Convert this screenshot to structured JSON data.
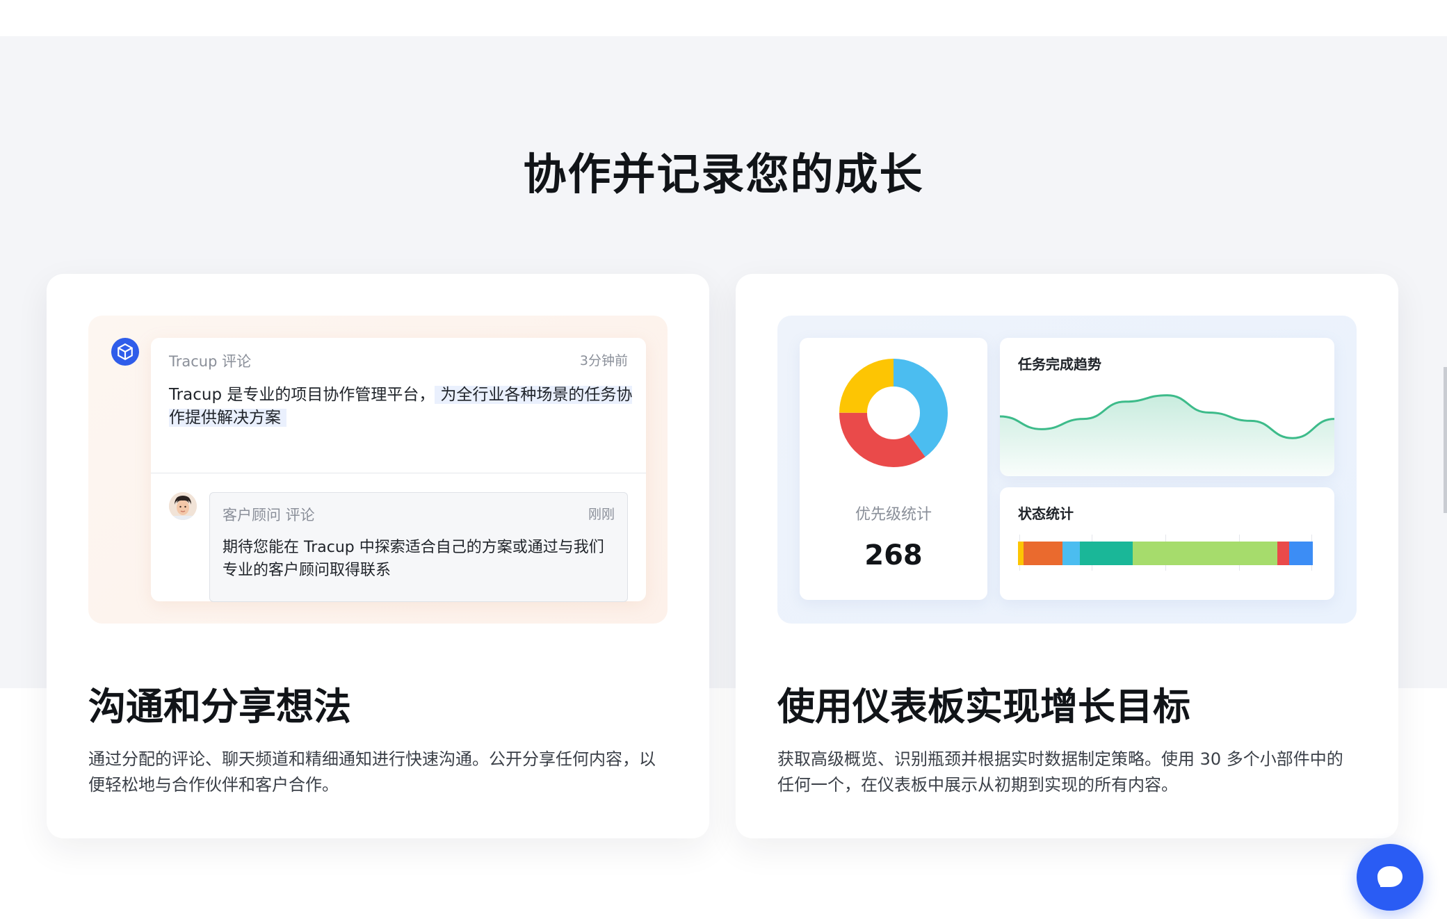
{
  "section": {
    "title": "协作并记录您的成长"
  },
  "left_card": {
    "heading": "沟通和分享想法",
    "description": "通过分配的评论、聊天频道和精细通知进行快速沟通。公开分享任何内容，以便轻松地与合作伙伴和客户合作。",
    "comment": {
      "author": "Tracup 评论",
      "time": "3分钟前",
      "body_plain": "Tracup 是专业的项目协作管理平台，",
      "body_highlight": "为全行业各种场景的任务协作提供解决方案"
    },
    "reply": {
      "author": "客户顾问   评论",
      "time": "刚刚",
      "body": "期待您能在 Tracup 中探索适合自己的方案或通过与我们专业的客户顾问取得联系"
    }
  },
  "right_card": {
    "heading": "使用仪表板实现增长目标",
    "description": "获取高级概览、识别瓶颈并根据实时数据制定策略。使用 30 多个小部件中的任何一个，在仪表板中展示从初期到实现的所有内容。",
    "priority": {
      "label": "优先级统计",
      "value": "268",
      "slices": [
        {
          "share": 0.4,
          "color": "#4bbdf0"
        },
        {
          "share": 0.35,
          "color": "#ea4a4a"
        },
        {
          "share": 0.25,
          "color": "#fdc503"
        }
      ]
    },
    "trend": {
      "title": "任务完成趋势",
      "line_color": "#3dbb8a",
      "points": [
        0.62,
        0.42,
        0.58,
        0.85,
        0.95,
        0.68,
        0.55,
        0.28,
        0.58
      ]
    },
    "status": {
      "title": "状态统计",
      "segments": [
        {
          "share": 0.02,
          "color": "#fdc503"
        },
        {
          "share": 0.13,
          "color": "#ea6a2e"
        },
        {
          "share": 0.06,
          "color": "#4bbdf0"
        },
        {
          "share": 0.18,
          "color": "#1ab798"
        },
        {
          "share": 0.49,
          "color": "#a6dc6c"
        },
        {
          "share": 0.04,
          "color": "#ea4a4a"
        },
        {
          "share": 0.08,
          "color": "#3c8df5"
        }
      ]
    }
  },
  "icons": {
    "logo": "tracup-cube-icon",
    "chat": "chat-bubble-icon"
  }
}
